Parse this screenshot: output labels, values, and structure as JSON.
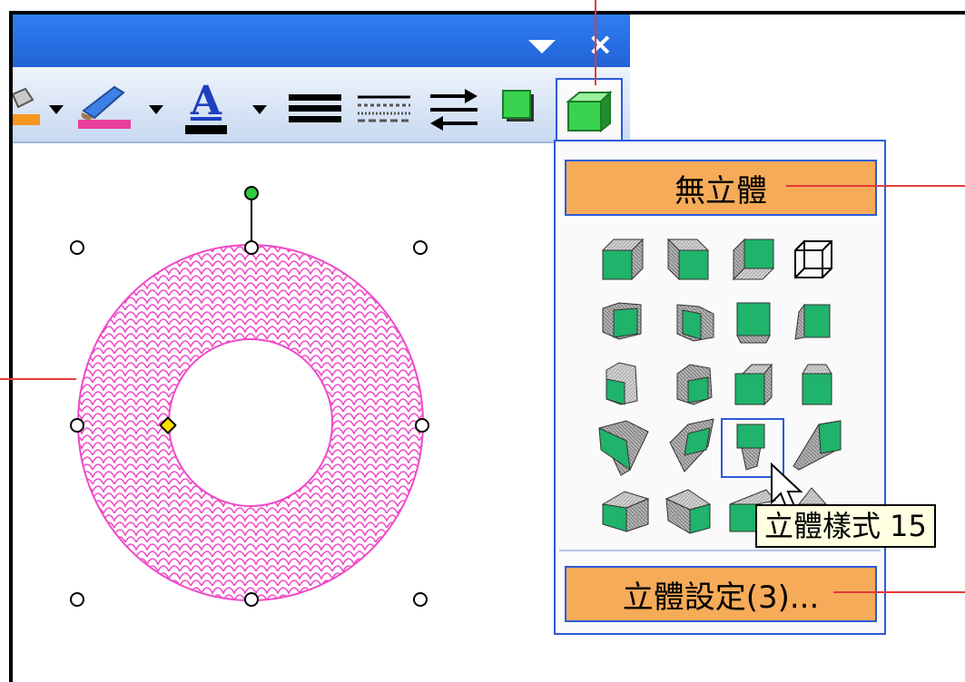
{
  "window": {
    "icons": {
      "dropdown": "triangle-down-icon",
      "close": "x-icon"
    },
    "close_glyph": "×"
  },
  "toolbar": {
    "items": [
      "fill-color-icon",
      "line-color-icon",
      "font-color-icon",
      "line-style-icon",
      "dash-style-icon",
      "arrow-style-icon",
      "shadow-icon",
      "3d-icon"
    ],
    "font_color_letter": "A"
  },
  "menu_3d": {
    "no_3d_label": "無立體",
    "settings_label": "立體設定(3)...",
    "style_grid_rows": 5,
    "style_grid_cols": 4,
    "selected_style": 15,
    "tooltip": "立體樣式 15"
  },
  "colors": {
    "title_bar": "#2f7ef3",
    "menu_button": "#f6ab59",
    "panel_border": "#2b5bd8",
    "shape_face": "#1fb36b",
    "donut_pattern": "#f04ac8",
    "callout": "#e23b3b"
  }
}
